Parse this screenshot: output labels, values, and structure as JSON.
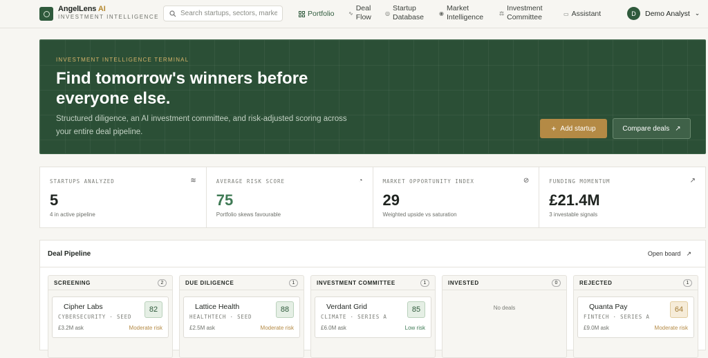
{
  "header": {
    "brand_name": "AngelLens",
    "brand_ai": "AI",
    "brand_sub": "INVESTMENT INTELLIGENCE",
    "search_placeholder": "Search startups, sectors, markets",
    "nav": [
      {
        "label": "Portfolio",
        "icon": "grid-icon"
      },
      {
        "label": "Deal Flow",
        "icon": "pulse-icon"
      },
      {
        "label": "Startup Database",
        "icon": "database-icon"
      },
      {
        "label": "Market Intelligence",
        "icon": "globe-icon"
      },
      {
        "label": "Investment Committee",
        "icon": "gavel-icon"
      },
      {
        "label": "Assistant",
        "icon": "chat-icon"
      }
    ],
    "user_initial": "D",
    "user_name": "Demo Analyst"
  },
  "hero": {
    "kicker": "INVESTMENT INTELLIGENCE TERMINAL",
    "title": "Find tomorrow's winners before everyone else.",
    "subtitle": "Structured diligence, an AI investment committee, and risk-adjusted scoring across your entire deal pipeline.",
    "add_label": "Add startup",
    "compare_label": "Compare deals"
  },
  "stats": [
    {
      "label": "STARTUPS ANALYZED",
      "value": "5",
      "note": "4 in active pipeline",
      "icon": "layers-icon"
    },
    {
      "label": "AVERAGE RISK SCORE",
      "value": "75",
      "note": "Portfolio skews favourable",
      "icon": "gauge-icon"
    },
    {
      "label": "MARKET OPPORTUNITY INDEX",
      "value": "29",
      "note": "Weighted upside vs saturation",
      "icon": "compass-icon"
    },
    {
      "label": "FUNDING MOMENTUM",
      "value": "£21.4M",
      "note": "3 investable signals",
      "icon": "trend-up-icon"
    }
  ],
  "pipeline": {
    "title": "Deal Pipeline",
    "open_board": "Open board",
    "columns": [
      {
        "title": "SCREENING",
        "count": "2",
        "card": {
          "name": "Cipher Labs",
          "meta": "CYBERSECURITY · SEED",
          "ask": "£3.2M ask",
          "risk": "Moderate risk",
          "score": "82"
        }
      },
      {
        "title": "DUE DILIGENCE",
        "count": "1",
        "card": {
          "name": "Lattice Health",
          "meta": "HEALTHTECH · SEED",
          "ask": "£2.5M ask",
          "risk": "Moderate risk",
          "score": "88"
        }
      },
      {
        "title": "INVESTMENT COMMITTEE",
        "count": "1",
        "card": {
          "name": "Verdant Grid",
          "meta": "CLIMATE · SERIES A",
          "ask": "£6.0M ask",
          "risk": "Low risk",
          "score": "85"
        }
      },
      {
        "title": "INVESTED",
        "count": "0",
        "empty": "No deals"
      },
      {
        "title": "REJECTED",
        "count": "1",
        "card": {
          "name": "Quanta Pay",
          "meta": "FINTECH · SERIES A",
          "ask": "£9.0M ask",
          "risk": "Moderate risk",
          "score": "64"
        }
      }
    ]
  }
}
